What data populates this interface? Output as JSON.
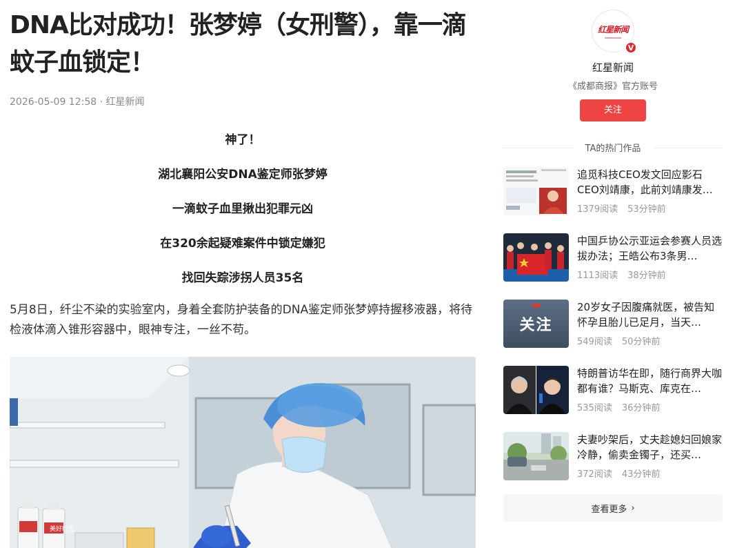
{
  "article": {
    "title": "DNA比对成功！张梦婷（女刑警），靠一滴蚊子血锁定！",
    "meta": "2026-05-09 12:58 · 红星新闻",
    "highlights": [
      "神了！",
      "湖北襄阳公安DNA鉴定师张梦婷",
      "一滴蚊子血里揪出犯罪元凶",
      "在320余起疑难案件中锁定嫌犯",
      "找回失踪涉拐人员35名"
    ],
    "paragraph": "5月8日，纤尘不染的实验室内，身着全套防护装备的DNA鉴定师张梦婷持握移液器，将待检液体滴入锥形容器中，眼神专注，一丝不苟。",
    "photo_label": "美好时光"
  },
  "author": {
    "logo_text": "红星新闻",
    "verified_badge": "V",
    "name": "红星新闻",
    "description": "《成都商报》官方账号",
    "follow_label": "关注"
  },
  "hot_works": {
    "heading": "TA的热门作品",
    "items": [
      {
        "title": "追觅科技CEO发文回应影石CEO刘靖康，此前刘靖康发…",
        "reads": "1379阅读",
        "time": "53分钟前"
      },
      {
        "title": "中国乒协公示亚运会参赛人员选拔办法；王皓公布3条男…",
        "reads": "1113阅读",
        "time": "38分钟前"
      },
      {
        "title": "20岁女子因腹痛就医，被告知怀孕且胎儿已足月，当天…",
        "reads": "549阅读",
        "time": "50分钟前",
        "thumb_text": "关注"
      },
      {
        "title": "特朗普访华在即，随行商界大咖都有谁？马斯克、库克在…",
        "reads": "535阅读",
        "time": "36分钟前"
      },
      {
        "title": "夫妻吵架后，丈夫趁媳妇回娘家冷静，偷卖金镯子，还买…",
        "reads": "372阅读",
        "time": "43分钟前"
      }
    ],
    "more_label": "查看更多"
  },
  "colors": {
    "follow_button": "#ef4444",
    "verified_badge": "#e0262f",
    "more_button_bg": "#f6f6f6"
  }
}
